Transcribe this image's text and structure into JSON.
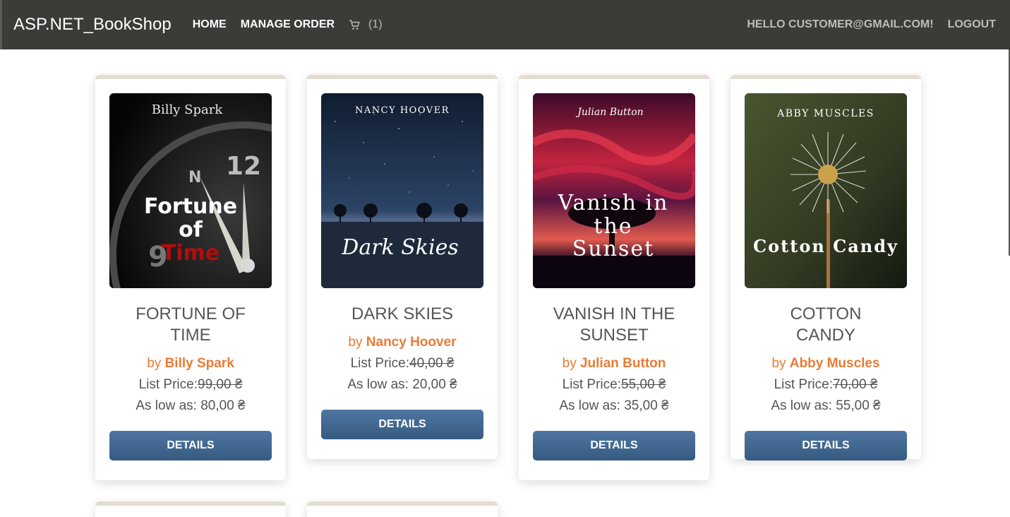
{
  "navbar": {
    "brand": "ASP.NET_BookShop",
    "home": "Home",
    "manage_order": "Manage Order",
    "cart_icon": "cart-icon",
    "cart_count": "(1)",
    "greeting": "Hello customer@gmail.com!",
    "logout": "Logout"
  },
  "labels": {
    "by": "by",
    "list_price": "List Price:",
    "as_low_as": "As low as:",
    "details": "Details",
    "currency": "₴"
  },
  "products": [
    {
      "title": "Fortune of Time",
      "author": "Billy Spark",
      "list_price": "99,00 ₴",
      "low_price": "80,00 ₴",
      "cover_author": "Billy Spark",
      "cover_title_lines": [
        "Fortune",
        "of",
        "Time"
      ]
    },
    {
      "title": "Dark Skies",
      "author": "Nancy Hoover",
      "list_price": "40,00 ₴",
      "low_price": "20,00 ₴",
      "cover_author": "NANCY HOOVER",
      "cover_title_lines": [
        "Dark Skies"
      ]
    },
    {
      "title": "Vanish in the Sunset",
      "author": "Julian Button",
      "list_price": "55,00 ₴",
      "low_price": "35,00 ₴",
      "cover_author": "Julian Button",
      "cover_title_lines": [
        "Vanish in",
        "the",
        "Sunset"
      ]
    },
    {
      "title": "Cotton Candy",
      "author": "Abby Muscles",
      "list_price": "70,00 ₴",
      "low_price": "55,00 ₴",
      "cover_author": "ABBY MUSCLES",
      "cover_title_lines": [
        "Cotton Candy"
      ]
    }
  ],
  "colors": {
    "navbar": "#3b3b37",
    "accent": "#ea7b35",
    "button": "#436a93",
    "card_top": "#e3ddd2"
  }
}
